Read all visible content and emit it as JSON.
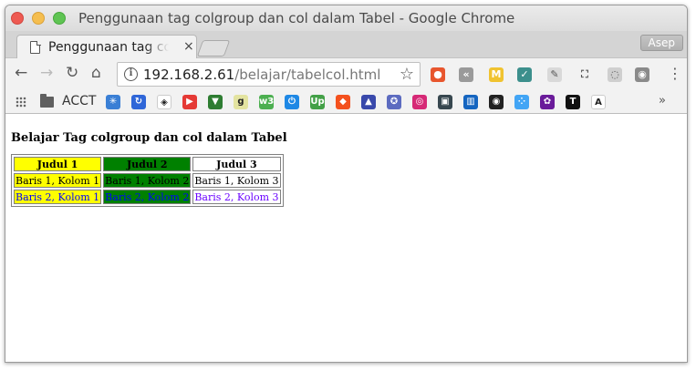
{
  "window": {
    "title": "Penggunaan tag colgroup dan col dalam Tabel - Google Chrome"
  },
  "tab": {
    "title": "Penggunaan tag colgroup dan col dalam Tabel",
    "close_glyph": "×"
  },
  "profile": {
    "name": "Asep"
  },
  "toolbar": {
    "back_glyph": "←",
    "forward_glyph": "→",
    "reload_glyph": "↻",
    "home_glyph": "⌂",
    "info_glyph": "i",
    "url_host": "192.168.2.61",
    "url_path": "/belajar/tabelcol.html",
    "star_glyph": "☆",
    "menu_glyph": "⋮"
  },
  "extensions": [
    {
      "icon": "ublock-icon",
      "color": "#e8562e",
      "glyph": "●"
    },
    {
      "icon": "rewind-icon",
      "color": "#9a9a9a",
      "glyph": "«"
    },
    {
      "icon": "m-extension-icon",
      "color": "#f0c330",
      "glyph": "M"
    },
    {
      "icon": "check-extension-icon",
      "color": "#3c8f8c",
      "glyph": "✓"
    },
    {
      "icon": "eraser-icon",
      "color": "#d9d9d9",
      "glyph": "✎"
    },
    {
      "icon": "crop-icon",
      "color": "#f2f2f2",
      "glyph": "⛶"
    },
    {
      "icon": "spinner-icon",
      "color": "#cfcfcf",
      "glyph": "◌"
    },
    {
      "icon": "camera-icon",
      "color": "#8a8a8a",
      "glyph": "◉"
    }
  ],
  "bookmarks": {
    "folder_label": "ACCT",
    "icons": [
      {
        "icon": "snowflake-icon",
        "color": "#3a7fd5",
        "glyph": "✳"
      },
      {
        "icon": "sync-icon",
        "color": "#2f66d8",
        "glyph": "↻"
      },
      {
        "icon": "codepen-icon",
        "color": "#ffffff",
        "glyph": "◈"
      },
      {
        "icon": "youtube-icon",
        "color": "#e53935",
        "glyph": "▶"
      },
      {
        "icon": "vuetify-icon",
        "color": "#2e7d32",
        "glyph": "▼"
      },
      {
        "icon": "g-icon",
        "color": "#e3e3a0",
        "glyph": "g"
      },
      {
        "icon": "w3-icon",
        "color": "#4caf50",
        "glyph": "w3"
      },
      {
        "icon": "power-icon",
        "color": "#1e88e5",
        "glyph": "⏻"
      },
      {
        "icon": "upwork-icon",
        "color": "#43a047",
        "glyph": "Up"
      },
      {
        "icon": "colorful-icon",
        "color": "#f4511e",
        "glyph": "◆"
      },
      {
        "icon": "delta-icon",
        "color": "#3949ab",
        "glyph": "▲"
      },
      {
        "icon": "emblem-icon",
        "color": "#5c6bc0",
        "glyph": "✪"
      },
      {
        "icon": "instagram-icon",
        "color": "#d62976",
        "glyph": "◎"
      },
      {
        "icon": "box-icon",
        "color": "#37474f",
        "glyph": "▣"
      },
      {
        "icon": "trello-icon",
        "color": "#1565c0",
        "glyph": "▥"
      },
      {
        "icon": "radio-icon",
        "color": "#212121",
        "glyph": "◉"
      },
      {
        "icon": "dots-icon",
        "color": "#42a5f5",
        "glyph": "⁘"
      },
      {
        "icon": "crest-icon",
        "color": "#6a1b9a",
        "glyph": "✿"
      },
      {
        "icon": "t-icon",
        "color": "#111111",
        "glyph": "T"
      },
      {
        "icon": "a-icon",
        "color": "#ffffff",
        "glyph": "A"
      }
    ],
    "more_glyph": "»"
  },
  "page": {
    "heading": "Belajar Tag colgroup dan col dalam Tabel",
    "table": {
      "headers": [
        "Judul 1",
        "Judul 2",
        "Judul 3"
      ],
      "rows": [
        [
          "Baris 1, Kolom 1",
          "Baris 1, Kolom 2",
          "Baris 1, Kolom 3"
        ],
        [
          "Baris 2, Kolom 1",
          "Baris 2, Kolom 2",
          "Baris 2, Kolom 3"
        ]
      ],
      "col_colors": {
        "col1_bg": "#ffff00",
        "col2_bg": "#008000",
        "col3_bg": "#ffffff",
        "row2_text": "#0000ff",
        "row2_col3_text": "#6a00ff",
        "row2_col2_text": "#0000ff"
      }
    }
  }
}
